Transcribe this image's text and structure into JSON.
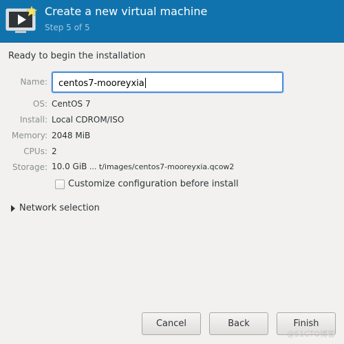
{
  "header": {
    "title": "Create a new virtual machine",
    "step": "Step 5 of 5",
    "icon": "virtual-machine-icon"
  },
  "intro": "Ready to begin the installation",
  "fields": {
    "name": {
      "label": "Name:",
      "value": "centos7-mooreyxia"
    },
    "os": {
      "label": "OS:",
      "value": "CentOS 7"
    },
    "install": {
      "label": "Install:",
      "value": "Local CDROM/ISO"
    },
    "memory": {
      "label": "Memory:",
      "value": "2048 MiB"
    },
    "cpus": {
      "label": "CPUs:",
      "value": "2"
    },
    "storage": {
      "label": "Storage:",
      "size": "10.0 GiB",
      "path": " ... t/images/centos7-mooreyxia.qcow2"
    }
  },
  "customize": {
    "label": "Customize configuration before install",
    "checked": false
  },
  "network": {
    "label": "Network selection",
    "expanded": false
  },
  "buttons": {
    "cancel": "Cancel",
    "back": "Back",
    "finish": "Finish"
  },
  "watermark": "@51CTO博客",
  "colors": {
    "header_bg": "#1173ad",
    "focus_border": "#4a90d9",
    "window_bg": "#f2f1f0"
  }
}
